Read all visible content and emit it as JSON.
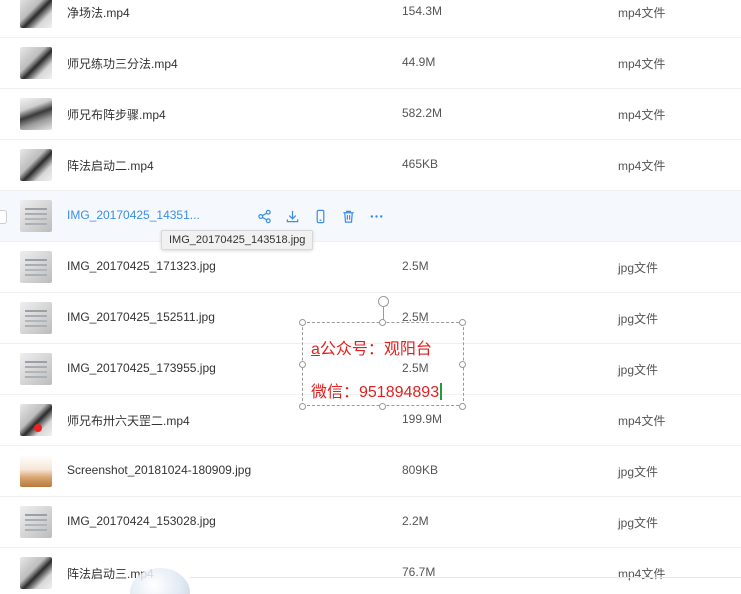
{
  "files": [
    {
      "name": "净场法.mp4",
      "size": "154.3M",
      "type": "mp4文件",
      "thumb": "video"
    },
    {
      "name": "师兄练功三分法.mp4",
      "size": "44.9M",
      "type": "mp4文件",
      "thumb": "video"
    },
    {
      "name": "师兄布阵步骤.mp4",
      "size": "582.2M",
      "type": "mp4文件",
      "thumb": "video2"
    },
    {
      "name": "阵法启动二.mp4",
      "size": "465KB",
      "type": "mp4文件",
      "thumb": "video"
    },
    {
      "name": "IMG_20170425_14351...",
      "size": "",
      "type": "",
      "thumb": "photo"
    },
    {
      "name": "IMG_20170425_171323.jpg",
      "size": "2.5M",
      "type": "jpg文件",
      "thumb": "photo"
    },
    {
      "name": "IMG_20170425_152511.jpg",
      "size": "2.5M",
      "type": "jpg文件",
      "thumb": "photo"
    },
    {
      "name": "IMG_20170425_173955.jpg",
      "size": "2.5M",
      "type": "jpg文件",
      "thumb": "photo"
    },
    {
      "name": "师兄布卅六天罡二.mp4",
      "size": "199.9M",
      "type": "mp4文件",
      "thumb": "video"
    },
    {
      "name": "Screenshot_20181024-180909.jpg",
      "size": "809KB",
      "type": "jpg文件",
      "thumb": "shot"
    },
    {
      "name": "IMG_20170424_153028.jpg",
      "size": "2.2M",
      "type": "jpg文件",
      "thumb": "photo"
    },
    {
      "name": "阵法启动三.mp4",
      "size": "76.7M",
      "type": "mp4文件",
      "thumb": "video"
    }
  ],
  "hover_row": {
    "index": 4,
    "actions": [
      "share-icon",
      "download-icon",
      "phone-icon",
      "trash-icon",
      "more-icon"
    ]
  },
  "tooltip": {
    "text": "IMG_20170425_143518.jpg"
  },
  "watermark": {
    "line1_first": "a",
    "line1_rest": "公众号：观阳台",
    "line2": "微信：951894893"
  },
  "colors": {
    "link": "#3a8ee6",
    "watermark": "#e02020",
    "hover_bg": "#f5f8fd"
  }
}
